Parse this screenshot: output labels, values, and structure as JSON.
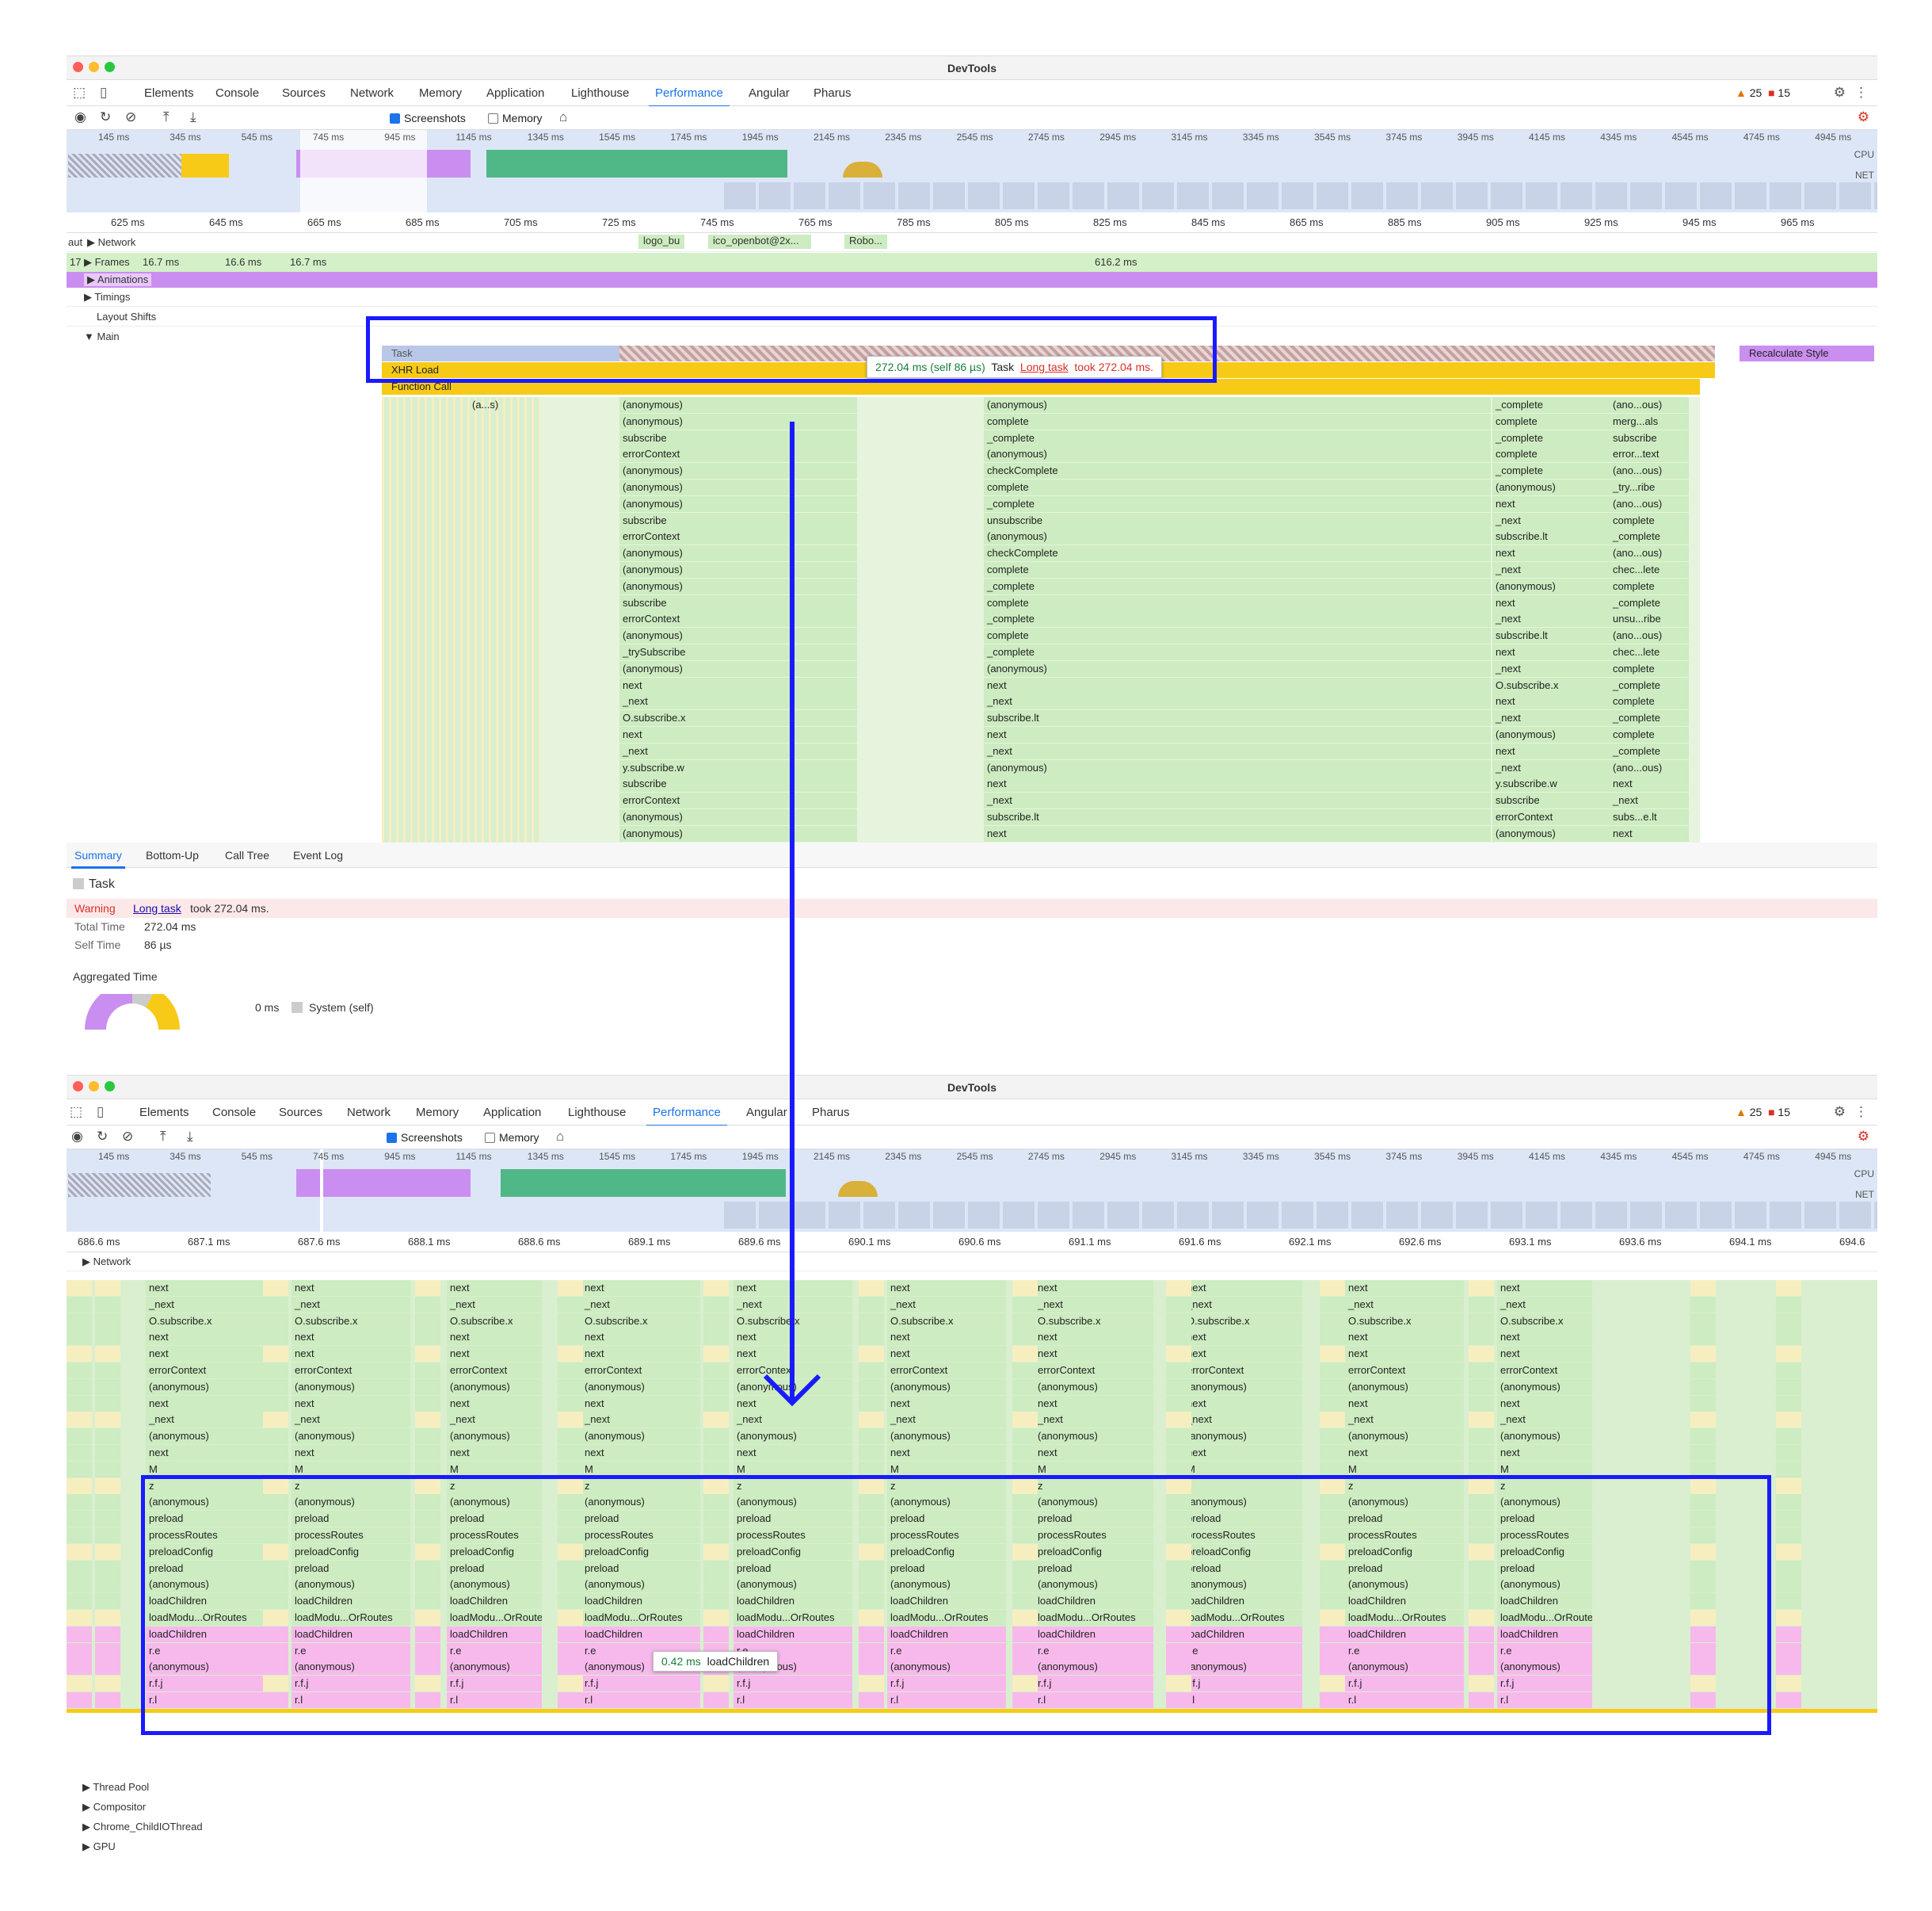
{
  "window": {
    "title": "DevTools"
  },
  "tabs": [
    "Elements",
    "Console",
    "Sources",
    "Network",
    "Memory",
    "Application",
    "Lighthouse",
    "Performance",
    "Angular",
    "Pharus"
  ],
  "active_tab": "Performance",
  "badges": {
    "warnings": "25",
    "errors": "15"
  },
  "toolbar": {
    "screenshots_label": "Screenshots",
    "memory_label": "Memory"
  },
  "overview": {
    "labels": [
      "145 ms",
      "345 ms",
      "545 ms",
      "745 ms",
      "945 ms",
      "1145 ms",
      "1345 ms",
      "1545 ms",
      "1745 ms",
      "1945 ms",
      "2145 ms",
      "2345 ms",
      "2545 ms",
      "2745 ms",
      "2945 ms",
      "3145 ms",
      "3345 ms",
      "3545 ms",
      "3745 ms",
      "3945 ms",
      "4145 ms",
      "4345 ms",
      "4545 ms",
      "4745 ms",
      "4945 ms"
    ],
    "cpu_label": "CPU",
    "net_label": "NET"
  },
  "top": {
    "ruler": [
      "625 ms",
      "645 ms",
      "665 ms",
      "685 ms",
      "705 ms",
      "725 ms",
      "745 ms",
      "765 ms",
      "785 ms",
      "805 ms",
      "825 ms",
      "845 ms",
      "865 ms",
      "885 ms",
      "905 ms",
      "925 ms",
      "945 ms",
      "965 ms"
    ],
    "network_prefix": "aut",
    "network_label": "Network",
    "network_items": [
      "logo_bu",
      "ico_openbot@2x...",
      "Robo..."
    ],
    "frames_prefix": "17",
    "frames_label": "Frames",
    "frames": [
      "16.7 ms",
      "16.6 ms",
      "16.7 ms",
      "616.2 ms"
    ],
    "tracks": [
      "Animations",
      "Timings",
      "Layout Shifts",
      "Main"
    ],
    "task": {
      "task": "Task",
      "xhr": "XHR Load",
      "fn": "Function Call",
      "recalc": "Recalculate Style",
      "short": "(a...s)"
    },
    "tooltip": {
      "time": "272.04 ms (self 86 µs)",
      "name": "Task",
      "link": "Long task",
      "rest": "took 272.04 ms."
    },
    "columns": [
      [
        "(anonymous)",
        "(anonymous)",
        "subscribe",
        "errorContext",
        "(anonymous)",
        "(anonymous)",
        "(anonymous)",
        "subscribe",
        "errorContext",
        "(anonymous)",
        "(anonymous)",
        "(anonymous)",
        "subscribe",
        "errorContext",
        "(anonymous)",
        "_trySubscribe",
        "(anonymous)",
        "next",
        "_next",
        "O.subscribe.x",
        "next",
        "_next",
        "y.subscribe.w",
        "subscribe",
        "errorContext",
        "(anonymous)",
        "(anonymous)"
      ],
      [
        "(anonymous)",
        "complete",
        "_complete",
        "(anonymous)",
        "checkComplete",
        "complete",
        "_complete",
        "unsubscribe",
        "(anonymous)",
        "checkComplete",
        "complete",
        "_complete",
        "complete",
        "_complete",
        "complete",
        "_complete",
        "(anonymous)",
        "next",
        "_next",
        "subscribe.lt",
        "next",
        "_next",
        "(anonymous)",
        "next",
        "_next",
        "subscribe.lt",
        "next"
      ],
      [
        "_complete",
        "complete",
        "_complete",
        "complete",
        "_complete",
        "(anonymous)",
        "next",
        "_next",
        "subscribe.lt",
        "next",
        "_next",
        "(anonymous)",
        "next",
        "_next",
        "subscribe.lt",
        "next",
        "_next",
        "O.subscribe.x",
        "next",
        "_next",
        "(anonymous)",
        "next",
        "_next",
        "y.subscribe.w",
        "subscribe",
        "errorContext",
        "(anonymous)"
      ],
      [
        "(ano...ous)",
        "merg...als",
        "subscribe",
        "error...text",
        "(ano...ous)",
        "_try...ribe",
        "(ano...ous)",
        "complete",
        "_complete",
        "(ano...ous)",
        "chec...lete",
        "complete",
        "_complete",
        "unsu...ribe",
        "(ano...ous)",
        "chec...lete",
        "complete",
        "_complete",
        "complete",
        "_complete",
        "complete",
        "_complete",
        "(ano...ous)",
        "next",
        "_next",
        "subs...e.lt",
        "next"
      ]
    ]
  },
  "summary": {
    "tabs": [
      "Summary",
      "Bottom-Up",
      "Call Tree",
      "Event Log"
    ],
    "title": "Task",
    "warning_label": "Warning",
    "warning_link": "Long task",
    "warning_text": "took 272.04 ms.",
    "total_label": "Total Time",
    "total_value": "272.04 ms",
    "self_label": "Self Time",
    "self_value": "86 µs",
    "aggregated": "Aggregated Time",
    "agg_value": "0 ms",
    "agg_legend": "System (self)"
  },
  "bottom": {
    "ruler": [
      "686.6 ms",
      "687.1 ms",
      "687.6 ms",
      "688.1 ms",
      "688.6 ms",
      "689.1 ms",
      "689.6 ms",
      "690.1 ms",
      "690.6 ms",
      "691.1 ms",
      "691.6 ms",
      "692.1 ms",
      "692.6 ms",
      "693.1 ms",
      "693.6 ms",
      "694.1 ms",
      "694.6"
    ],
    "network_label": "Network",
    "main_col": [
      "next",
      "_next",
      "O.subscribe.x",
      "next",
      "next",
      "errorContext",
      "(anonymous)",
      "next",
      "_next",
      "(anonymous)",
      "next",
      "M",
      "z",
      "(anonymous)",
      "preload",
      "processRoutes",
      "preloadConfig",
      "preload",
      "(anonymous)",
      "loadChildren",
      "loadModu...OrRoutes",
      "loadChildren",
      "r.e",
      "(anonymous)",
      "r.f.j",
      "r.l"
    ],
    "tooltip": {
      "time": "0.42 ms",
      "name": "loadChildren"
    },
    "threads": [
      "Thread Pool",
      "Compositor",
      "Chrome_ChildIOThread",
      "GPU"
    ]
  },
  "colors": {
    "accent": "#1a73e8",
    "highlight": "#1a1aff",
    "green": "#cdecc1",
    "pink": "#f7b9ec",
    "yellow": "#f7ca18",
    "purple": "#c98ef0"
  }
}
